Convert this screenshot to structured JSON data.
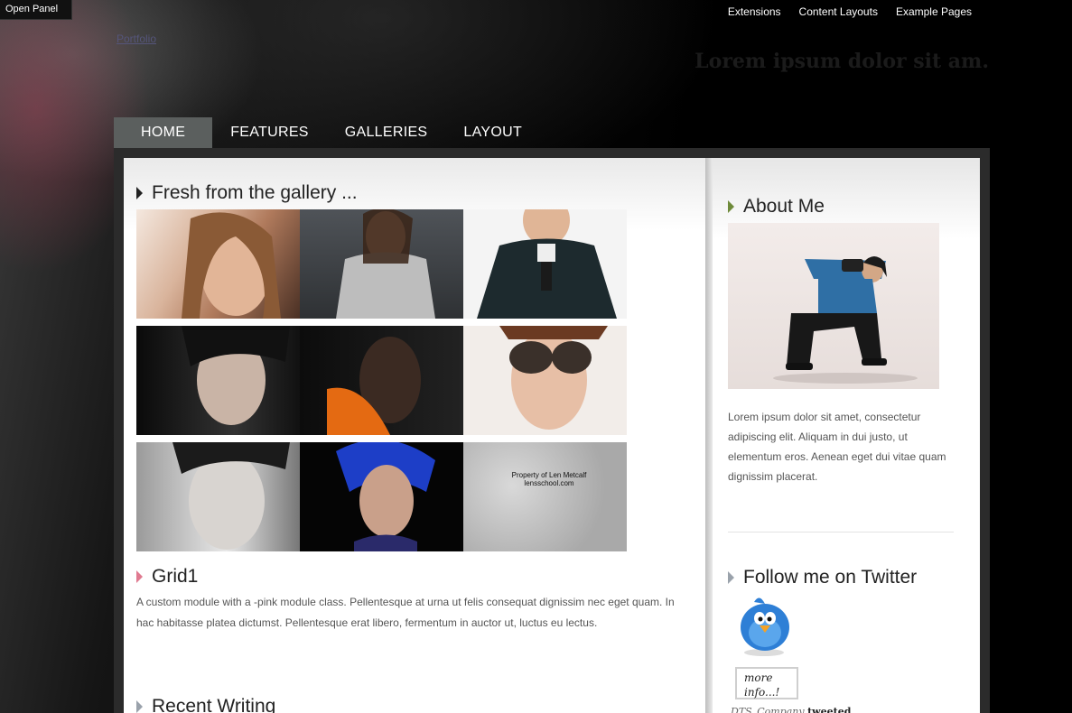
{
  "open_panel": "Open Panel",
  "top_links": [
    "Extensions",
    "Content Layouts",
    "Example Pages"
  ],
  "portfolio_link": "Portfolio",
  "tagline": "Lorem ipsum dolor sit am.",
  "nav": {
    "items": [
      {
        "label": "Home",
        "active": true
      },
      {
        "label": "Features"
      },
      {
        "label": "Galleries"
      },
      {
        "label": "Layout"
      }
    ]
  },
  "main": {
    "gallery_title": "Fresh from the gallery ...",
    "watermark": "Property of Len Metcalf lensschool.com",
    "grid_title": "Grid1",
    "grid_text": "A custom module with a -pink module class. Pellentesque at urna ut felis consequat dignissim nec eget quam. In hac habitasse platea dictumst. Pellentesque erat libero, fermentum in auctor ut, luctus eu lectus.",
    "recent_title": "Recent Writing"
  },
  "sidebar": {
    "about_title": "About Me",
    "about_text": "Lorem ipsum dolor sit amet, consectetur adipiscing elit. Aliquam in dui justo, ut elementum eros. Aenean eget dui vitae quam dignissim placerat.",
    "twitter_title": "Follow me on Twitter",
    "more_info": "more info...!",
    "tweet_user": "DTS_Company",
    "tweet_verb": "tweeted"
  },
  "colors": {
    "nav_active": "#5b5f5e",
    "arrow_pink": "#e07a90",
    "arrow_green": "#6e8a3a",
    "arrow_grey": "#9aa2ab"
  }
}
